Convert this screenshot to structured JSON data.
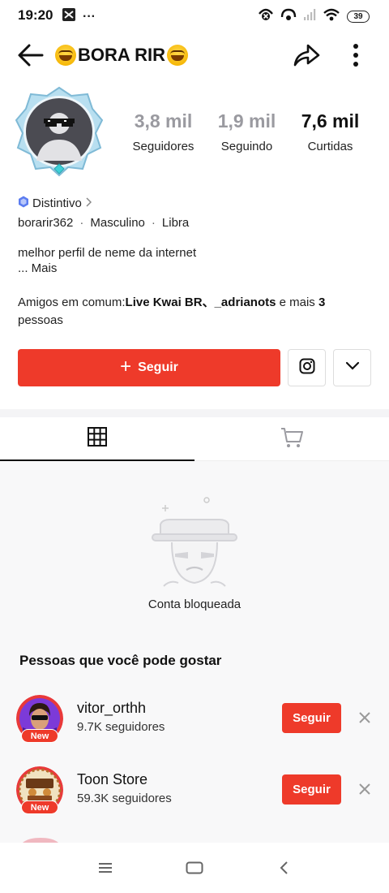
{
  "status": {
    "time": "19:20",
    "more_dots": "···",
    "battery": "39"
  },
  "header": {
    "title": "BORA RIR",
    "emoji_icon": "rofl-emoji-icon"
  },
  "stats": [
    {
      "value": "3,8 mil",
      "label": "Seguidores",
      "color": "#9a9aa0"
    },
    {
      "value": "1,9 mil",
      "label": "Seguindo",
      "color": "#9a9aa0"
    },
    {
      "value": "7,6 mil",
      "label": "Curtidas",
      "color": "#111111"
    }
  ],
  "profile": {
    "badge_label": "Distintivo",
    "username": "borarir362",
    "gender": "Masculino",
    "sign": "Libra",
    "bio_line1": "melhor perfil de neme da internet",
    "bio_more": "...  Mais",
    "friends_prefix": "Amigos em comum:",
    "friend1": "Live Kwai BR",
    "friend_sep": "、",
    "friend2": "_adrianots",
    "friends_middle": " e mais ",
    "friends_count": "3",
    "friends_suffix": " pessoas"
  },
  "actions": {
    "follow_plus": "+",
    "follow_label": "Seguir"
  },
  "content": {
    "blocked_text": "Conta bloqueada",
    "suggest_title": "Pessoas que você pode gostar"
  },
  "suggestions": [
    {
      "name": "vitor_orthh",
      "followers": "9.7K seguidores",
      "badge": "New",
      "follow": "Seguir"
    },
    {
      "name": "Toon Store",
      "followers": "59.3K seguidores",
      "badge": "New",
      "follow": "Seguir"
    }
  ],
  "colors": {
    "accent": "#ee3a2a",
    "badge_blue": "#5b7cf0"
  }
}
